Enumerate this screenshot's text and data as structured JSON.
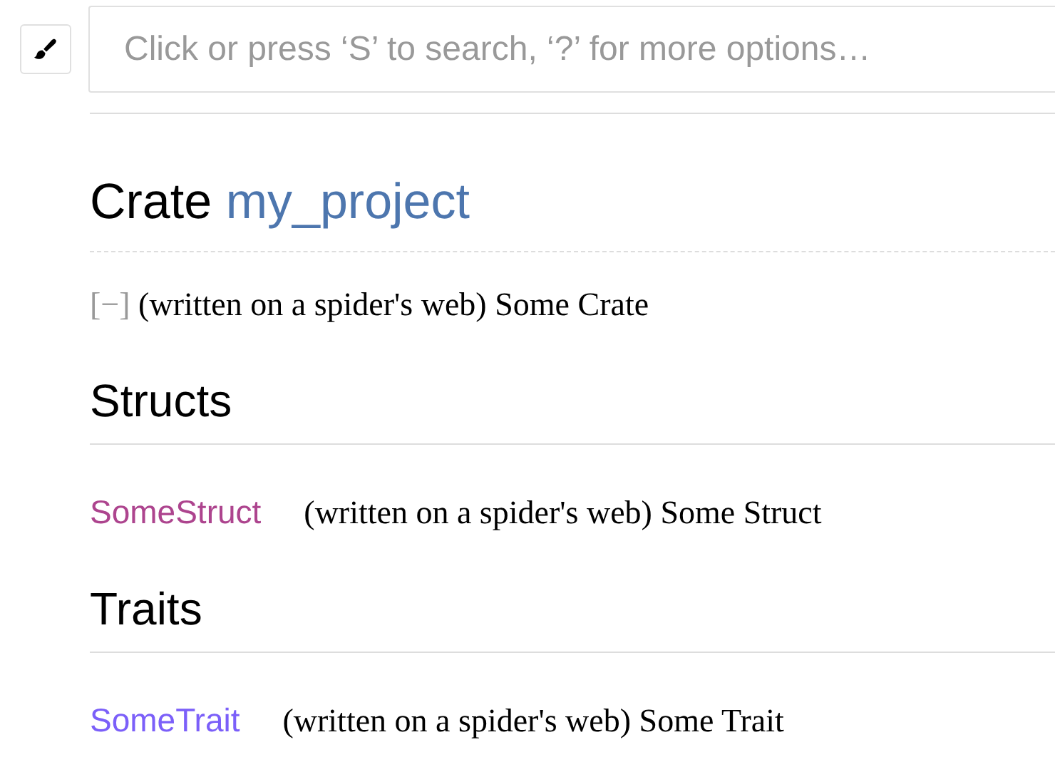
{
  "search": {
    "placeholder": "Click or press ‘S’ to search, ‘?’ for more options…"
  },
  "title": {
    "prefix": "Crate",
    "name": "my_project"
  },
  "crate_doc": {
    "toggle": "[−]",
    "text": "(written on a spider's web) Some Crate"
  },
  "sections": [
    {
      "heading": "Structs",
      "items": [
        {
          "kind": "struct",
          "name": "SomeStruct",
          "text": "(written on a spider's web) Some Struct"
        }
      ]
    },
    {
      "heading": "Traits",
      "items": [
        {
          "kind": "trait",
          "name": "SomeTrait",
          "text": "(written on a spider's web) Some Trait"
        }
      ]
    }
  ]
}
